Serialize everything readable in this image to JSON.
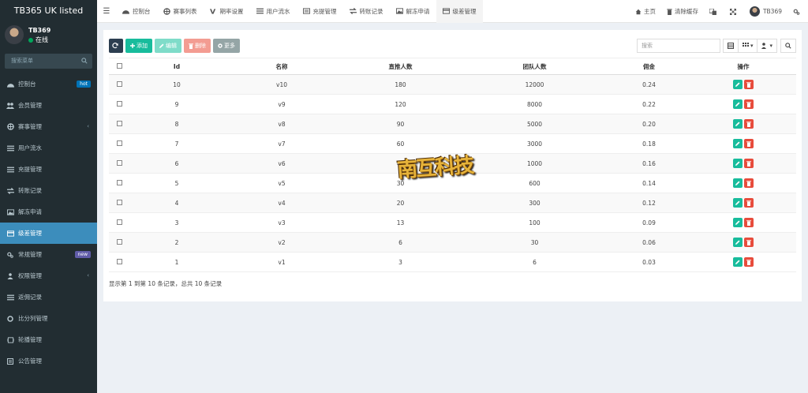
{
  "brand": "TB365 UK listed",
  "user": {
    "name": "TB369",
    "status": "在线"
  },
  "sidebar": {
    "search_placeholder": "搜索菜单",
    "items": [
      {
        "label": "控制台",
        "icon": "dashboard-icon",
        "badge": "hot"
      },
      {
        "label": "会员管理",
        "icon": "users-icon"
      },
      {
        "label": "赛事管理",
        "icon": "globe-icon",
        "caret": "‹"
      },
      {
        "label": "用户流水",
        "icon": "list-icon"
      },
      {
        "label": "充提管理",
        "icon": "list-icon"
      },
      {
        "label": "转账记录",
        "icon": "transfer-icon"
      },
      {
        "label": "解冻申请",
        "icon": "image-icon"
      },
      {
        "label": "级差管理",
        "icon": "card-icon",
        "active": true
      },
      {
        "label": "常规管理",
        "icon": "cogs-icon",
        "badge": "new"
      },
      {
        "label": "权限管理",
        "icon": "group-icon",
        "caret": "‹"
      },
      {
        "label": "返佣记录",
        "icon": "list-icon"
      },
      {
        "label": "比分列管理",
        "icon": "circle-icon"
      },
      {
        "label": "轮播管理",
        "icon": "slides-icon"
      },
      {
        "label": "公告管理",
        "icon": "notice-icon"
      }
    ]
  },
  "navbar": {
    "tabs": [
      {
        "label": "控制台",
        "icon": "dashboard-icon"
      },
      {
        "label": "赛事列表",
        "icon": "globe-icon"
      },
      {
        "label": "期率设置",
        "icon": "vk-icon"
      },
      {
        "label": "用户流水",
        "icon": "list-icon"
      },
      {
        "label": "充提管理",
        "icon": "list-alt-icon"
      },
      {
        "label": "转账记录",
        "icon": "transfer-icon"
      },
      {
        "label": "解冻申请",
        "icon": "image-icon"
      },
      {
        "label": "级差管理",
        "icon": "card-icon",
        "active": true
      }
    ],
    "right": {
      "home": "主页",
      "clear_cache": "清除缓存",
      "username": "TB369"
    }
  },
  "toolbar": {
    "add": "添加",
    "edit": "编辑",
    "delete": "删除",
    "more": "更多",
    "search_placeholder": "搜索"
  },
  "table": {
    "columns": [
      "Id",
      "名称",
      "直推人数",
      "团队人数",
      "佣金",
      "操作"
    ],
    "rows": [
      [
        "10",
        "v10",
        "180",
        "12000",
        "0.24"
      ],
      [
        "9",
        "v9",
        "120",
        "8000",
        "0.22"
      ],
      [
        "8",
        "v8",
        "90",
        "5000",
        "0.20"
      ],
      [
        "7",
        "v7",
        "60",
        "3000",
        "0.18"
      ],
      [
        "6",
        "v6",
        "40",
        "1000",
        "0.16"
      ],
      [
        "5",
        "v5",
        "30",
        "600",
        "0.14"
      ],
      [
        "4",
        "v4",
        "20",
        "300",
        "0.12"
      ],
      [
        "3",
        "v3",
        "13",
        "100",
        "0.09"
      ],
      [
        "2",
        "v2",
        "6",
        "30",
        "0.06"
      ],
      [
        "1",
        "v1",
        "3",
        "6",
        "0.03"
      ]
    ]
  },
  "footer": "显示第 1 到第 10 条记录，总共 10 条记录",
  "watermark": "南互科技",
  "colors": {
    "sidebar_bg": "#222d32",
    "active": "#3c8dbc",
    "success": "#18bc9c",
    "danger": "#e74c3c"
  }
}
